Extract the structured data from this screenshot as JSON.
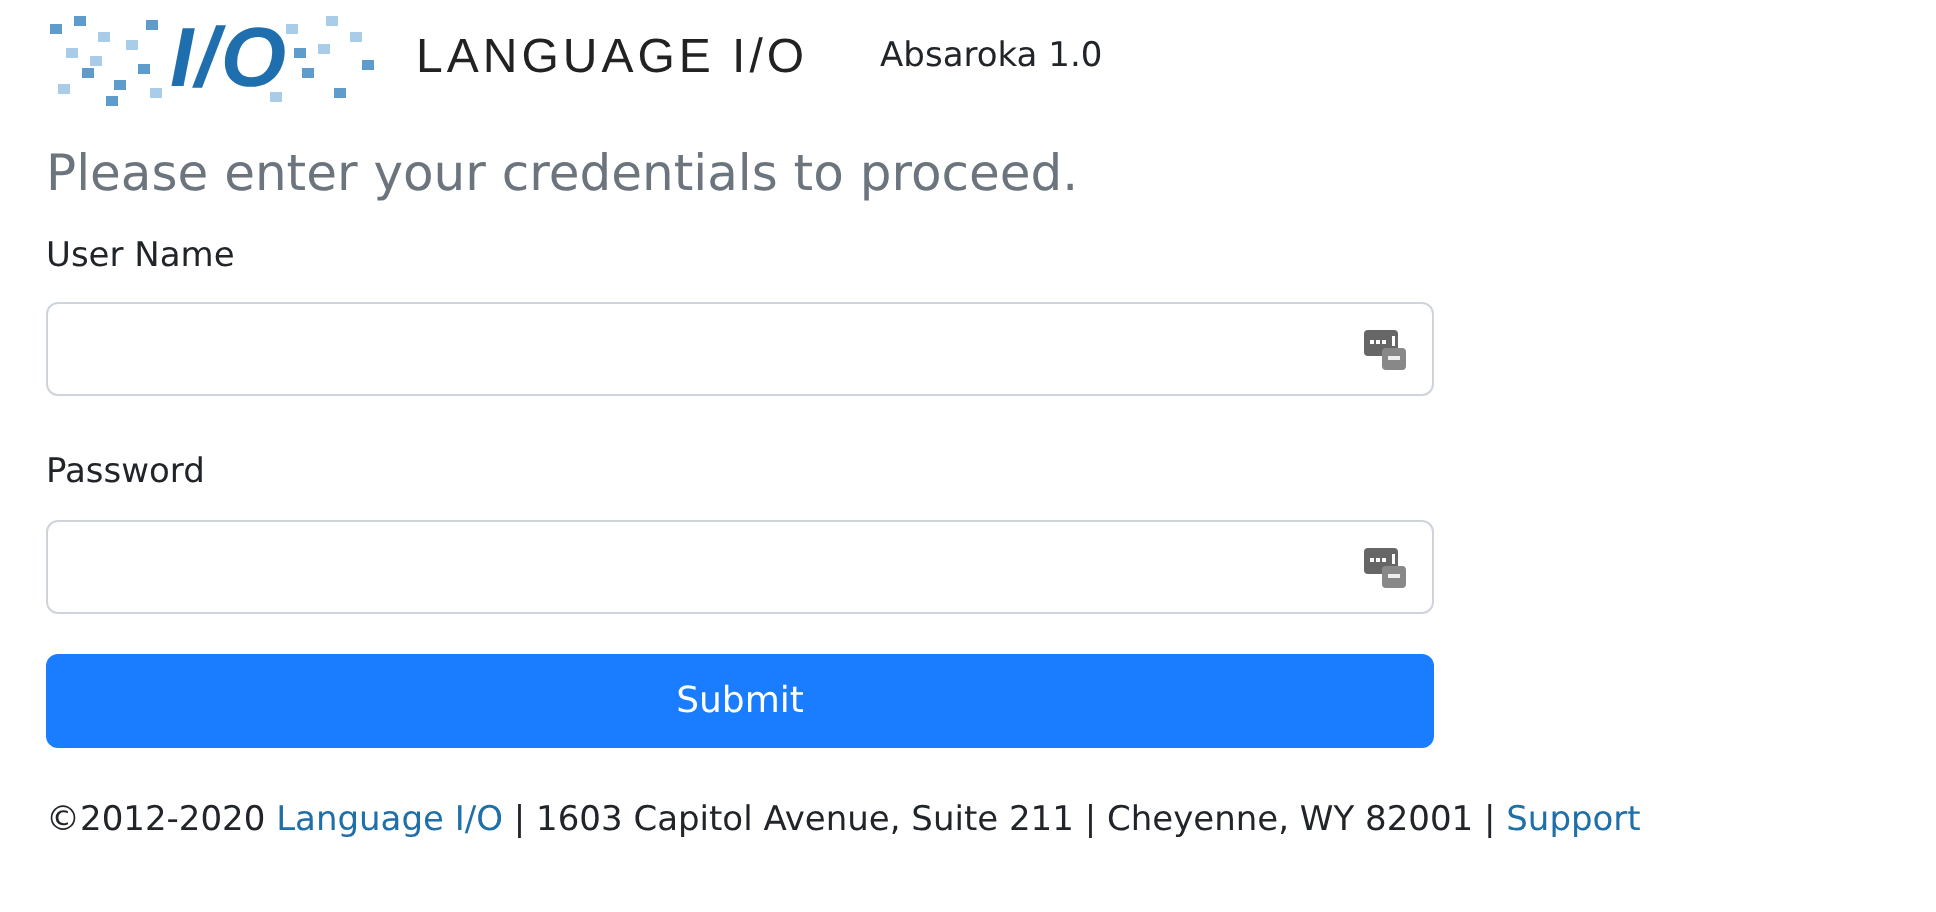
{
  "header": {
    "logo_mark": "I/O",
    "logo_text": "LANGUAGE I/O",
    "version": "Absaroka 1.0"
  },
  "heading": "Please enter your credentials to proceed.",
  "fields": [
    {
      "label": "User Name"
    },
    {
      "label": "Password"
    }
  ],
  "submit": "Submit",
  "footer": {
    "copyright": "©2012-2020",
    "company_link": "Language I/O",
    "address": "| 1603 Capitol Avenue, Suite 211 | Cheyenne, WY 82001 |",
    "support_link": "Support"
  }
}
